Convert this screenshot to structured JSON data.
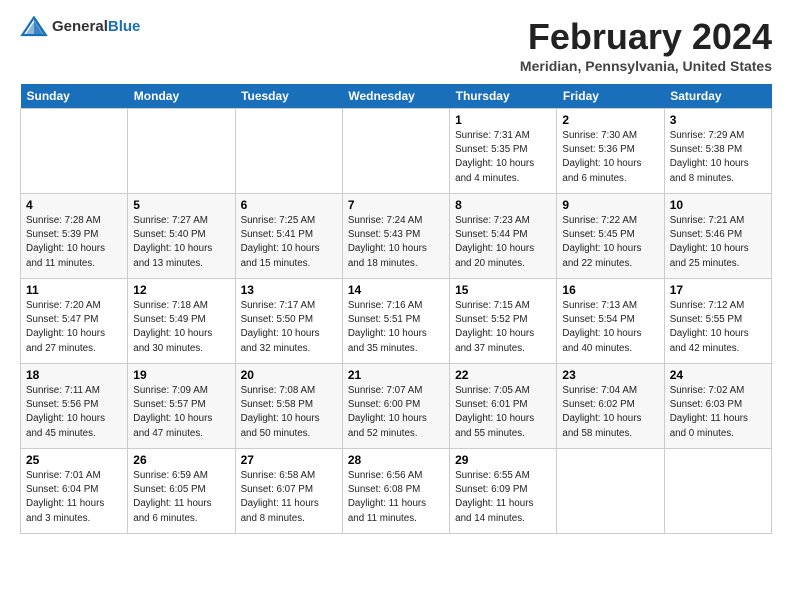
{
  "header": {
    "logo_general": "General",
    "logo_blue": "Blue",
    "month": "February 2024",
    "location": "Meridian, Pennsylvania, United States"
  },
  "weekdays": [
    "Sunday",
    "Monday",
    "Tuesday",
    "Wednesday",
    "Thursday",
    "Friday",
    "Saturday"
  ],
  "weeks": [
    [
      {
        "day": "",
        "info": ""
      },
      {
        "day": "",
        "info": ""
      },
      {
        "day": "",
        "info": ""
      },
      {
        "day": "",
        "info": ""
      },
      {
        "day": "1",
        "info": "Sunrise: 7:31 AM\nSunset: 5:35 PM\nDaylight: 10 hours\nand 4 minutes."
      },
      {
        "day": "2",
        "info": "Sunrise: 7:30 AM\nSunset: 5:36 PM\nDaylight: 10 hours\nand 6 minutes."
      },
      {
        "day": "3",
        "info": "Sunrise: 7:29 AM\nSunset: 5:38 PM\nDaylight: 10 hours\nand 8 minutes."
      }
    ],
    [
      {
        "day": "4",
        "info": "Sunrise: 7:28 AM\nSunset: 5:39 PM\nDaylight: 10 hours\nand 11 minutes."
      },
      {
        "day": "5",
        "info": "Sunrise: 7:27 AM\nSunset: 5:40 PM\nDaylight: 10 hours\nand 13 minutes."
      },
      {
        "day": "6",
        "info": "Sunrise: 7:25 AM\nSunset: 5:41 PM\nDaylight: 10 hours\nand 15 minutes."
      },
      {
        "day": "7",
        "info": "Sunrise: 7:24 AM\nSunset: 5:43 PM\nDaylight: 10 hours\nand 18 minutes."
      },
      {
        "day": "8",
        "info": "Sunrise: 7:23 AM\nSunset: 5:44 PM\nDaylight: 10 hours\nand 20 minutes."
      },
      {
        "day": "9",
        "info": "Sunrise: 7:22 AM\nSunset: 5:45 PM\nDaylight: 10 hours\nand 22 minutes."
      },
      {
        "day": "10",
        "info": "Sunrise: 7:21 AM\nSunset: 5:46 PM\nDaylight: 10 hours\nand 25 minutes."
      }
    ],
    [
      {
        "day": "11",
        "info": "Sunrise: 7:20 AM\nSunset: 5:47 PM\nDaylight: 10 hours\nand 27 minutes."
      },
      {
        "day": "12",
        "info": "Sunrise: 7:18 AM\nSunset: 5:49 PM\nDaylight: 10 hours\nand 30 minutes."
      },
      {
        "day": "13",
        "info": "Sunrise: 7:17 AM\nSunset: 5:50 PM\nDaylight: 10 hours\nand 32 minutes."
      },
      {
        "day": "14",
        "info": "Sunrise: 7:16 AM\nSunset: 5:51 PM\nDaylight: 10 hours\nand 35 minutes."
      },
      {
        "day": "15",
        "info": "Sunrise: 7:15 AM\nSunset: 5:52 PM\nDaylight: 10 hours\nand 37 minutes."
      },
      {
        "day": "16",
        "info": "Sunrise: 7:13 AM\nSunset: 5:54 PM\nDaylight: 10 hours\nand 40 minutes."
      },
      {
        "day": "17",
        "info": "Sunrise: 7:12 AM\nSunset: 5:55 PM\nDaylight: 10 hours\nand 42 minutes."
      }
    ],
    [
      {
        "day": "18",
        "info": "Sunrise: 7:11 AM\nSunset: 5:56 PM\nDaylight: 10 hours\nand 45 minutes."
      },
      {
        "day": "19",
        "info": "Sunrise: 7:09 AM\nSunset: 5:57 PM\nDaylight: 10 hours\nand 47 minutes."
      },
      {
        "day": "20",
        "info": "Sunrise: 7:08 AM\nSunset: 5:58 PM\nDaylight: 10 hours\nand 50 minutes."
      },
      {
        "day": "21",
        "info": "Sunrise: 7:07 AM\nSunset: 6:00 PM\nDaylight: 10 hours\nand 52 minutes."
      },
      {
        "day": "22",
        "info": "Sunrise: 7:05 AM\nSunset: 6:01 PM\nDaylight: 10 hours\nand 55 minutes."
      },
      {
        "day": "23",
        "info": "Sunrise: 7:04 AM\nSunset: 6:02 PM\nDaylight: 10 hours\nand 58 minutes."
      },
      {
        "day": "24",
        "info": "Sunrise: 7:02 AM\nSunset: 6:03 PM\nDaylight: 11 hours\nand 0 minutes."
      }
    ],
    [
      {
        "day": "25",
        "info": "Sunrise: 7:01 AM\nSunset: 6:04 PM\nDaylight: 11 hours\nand 3 minutes."
      },
      {
        "day": "26",
        "info": "Sunrise: 6:59 AM\nSunset: 6:05 PM\nDaylight: 11 hours\nand 6 minutes."
      },
      {
        "day": "27",
        "info": "Sunrise: 6:58 AM\nSunset: 6:07 PM\nDaylight: 11 hours\nand 8 minutes."
      },
      {
        "day": "28",
        "info": "Sunrise: 6:56 AM\nSunset: 6:08 PM\nDaylight: 11 hours\nand 11 minutes."
      },
      {
        "day": "29",
        "info": "Sunrise: 6:55 AM\nSunset: 6:09 PM\nDaylight: 11 hours\nand 14 minutes."
      },
      {
        "day": "",
        "info": ""
      },
      {
        "day": "",
        "info": ""
      }
    ]
  ]
}
